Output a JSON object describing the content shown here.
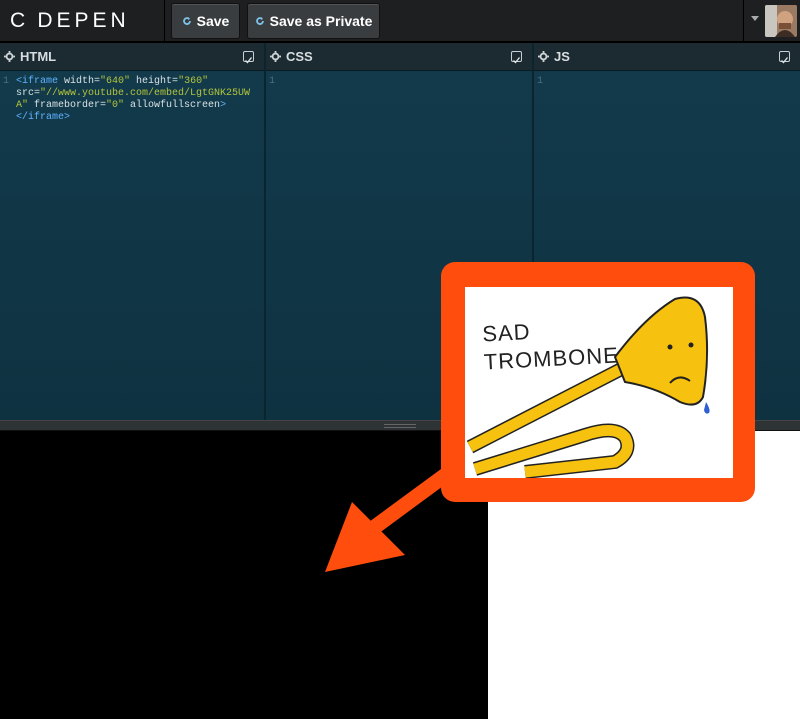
{
  "header": {
    "logo_text": "C DEPEN",
    "save_label": "Save",
    "save_private_label": "Save as Private",
    "refresh_icon": "refresh-icon",
    "avatar_icon": "user-avatar",
    "dropdown_icon": "chevron-down-icon"
  },
  "editors": [
    {
      "title": "HTML",
      "line": "1"
    },
    {
      "title": "CSS",
      "line": "1"
    },
    {
      "title": "JS",
      "line": "1"
    }
  ],
  "html_code": {
    "tag_open": "<iframe",
    "width_attr": " width=",
    "width_val": "\"640\"",
    "height_attr": " height=",
    "height_val": "\"360\"",
    "src_attr": "src=",
    "src_val": "\"//www.youtube.com/embed/LgtGNK25UWA\"",
    "frameborder_attr": " frameborder=",
    "frameborder_val": "\"0\"",
    "allowfullscreen": " allowfullscreen",
    "tag_close_bracket": ">",
    "close_tag": "</iframe>"
  },
  "callout": {
    "text_line1": "SAD",
    "text_line2": "TROMBONE",
    "accent_color": "#ff4d0d",
    "trombone_color": "#f6c20f"
  }
}
